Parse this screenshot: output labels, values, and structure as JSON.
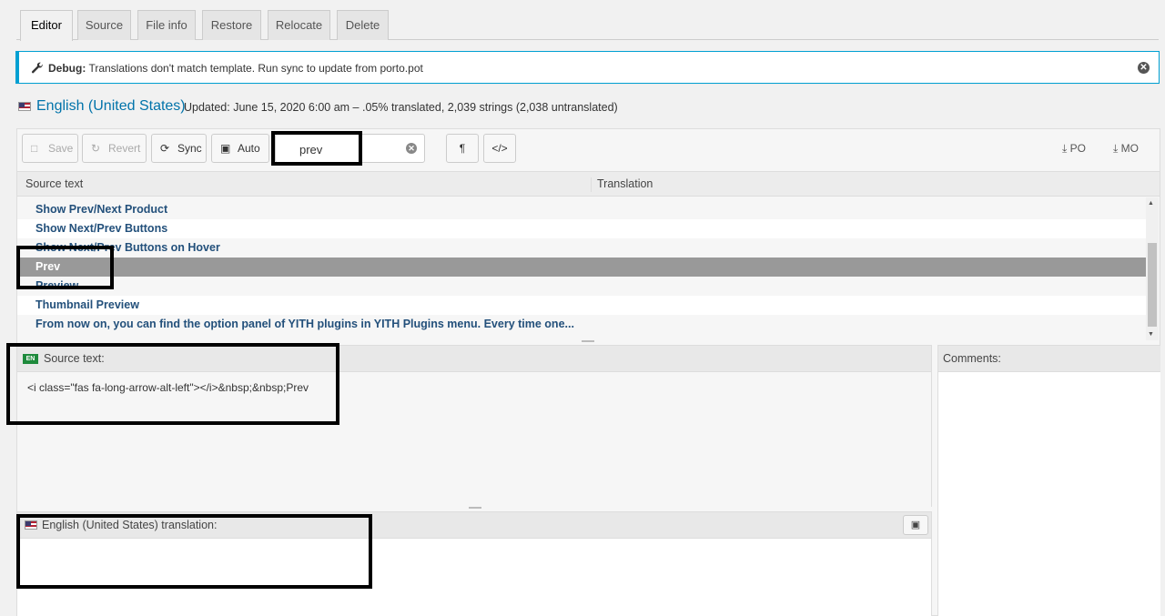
{
  "tabs": [
    "Editor",
    "Source",
    "File info",
    "Restore",
    "Relocate",
    "Delete"
  ],
  "notice": {
    "label": "Debug:",
    "message": "Translations don't match template. Run sync to update from porto.pot"
  },
  "header": {
    "language": "English (United States)",
    "meta": "Updated: June 15, 2020 6:00 am – .05% translated, 2,039 strings (2,038 untranslated)"
  },
  "toolbar": {
    "save": "Save",
    "revert": "Revert",
    "sync": "Sync",
    "auto": "Auto",
    "search_value": "prev",
    "pilcrow": "¶",
    "code": "</>",
    "po": "PO",
    "mo": "MO"
  },
  "grid": {
    "col_source": "Source text",
    "col_translation": "Translation",
    "rows": [
      "Show Prev/Next Product",
      "Show Next/Prev Buttons",
      "Show Next/Prev Buttons on Hover",
      "Prev",
      "Preview",
      "Thumbnail Preview",
      "From now on, you can find the option panel of YITH plugins in YITH Plugins menu. Every time one..."
    ],
    "selected_index": 3
  },
  "source_box": {
    "badge": "EN",
    "label": "Source text:",
    "content": "<i class=\"fas fa-long-arrow-alt-left\"></i>&nbsp;&nbsp;Prev"
  },
  "translation_box": {
    "label": "English (United States) translation:"
  },
  "comments_box": {
    "label": "Comments:"
  }
}
